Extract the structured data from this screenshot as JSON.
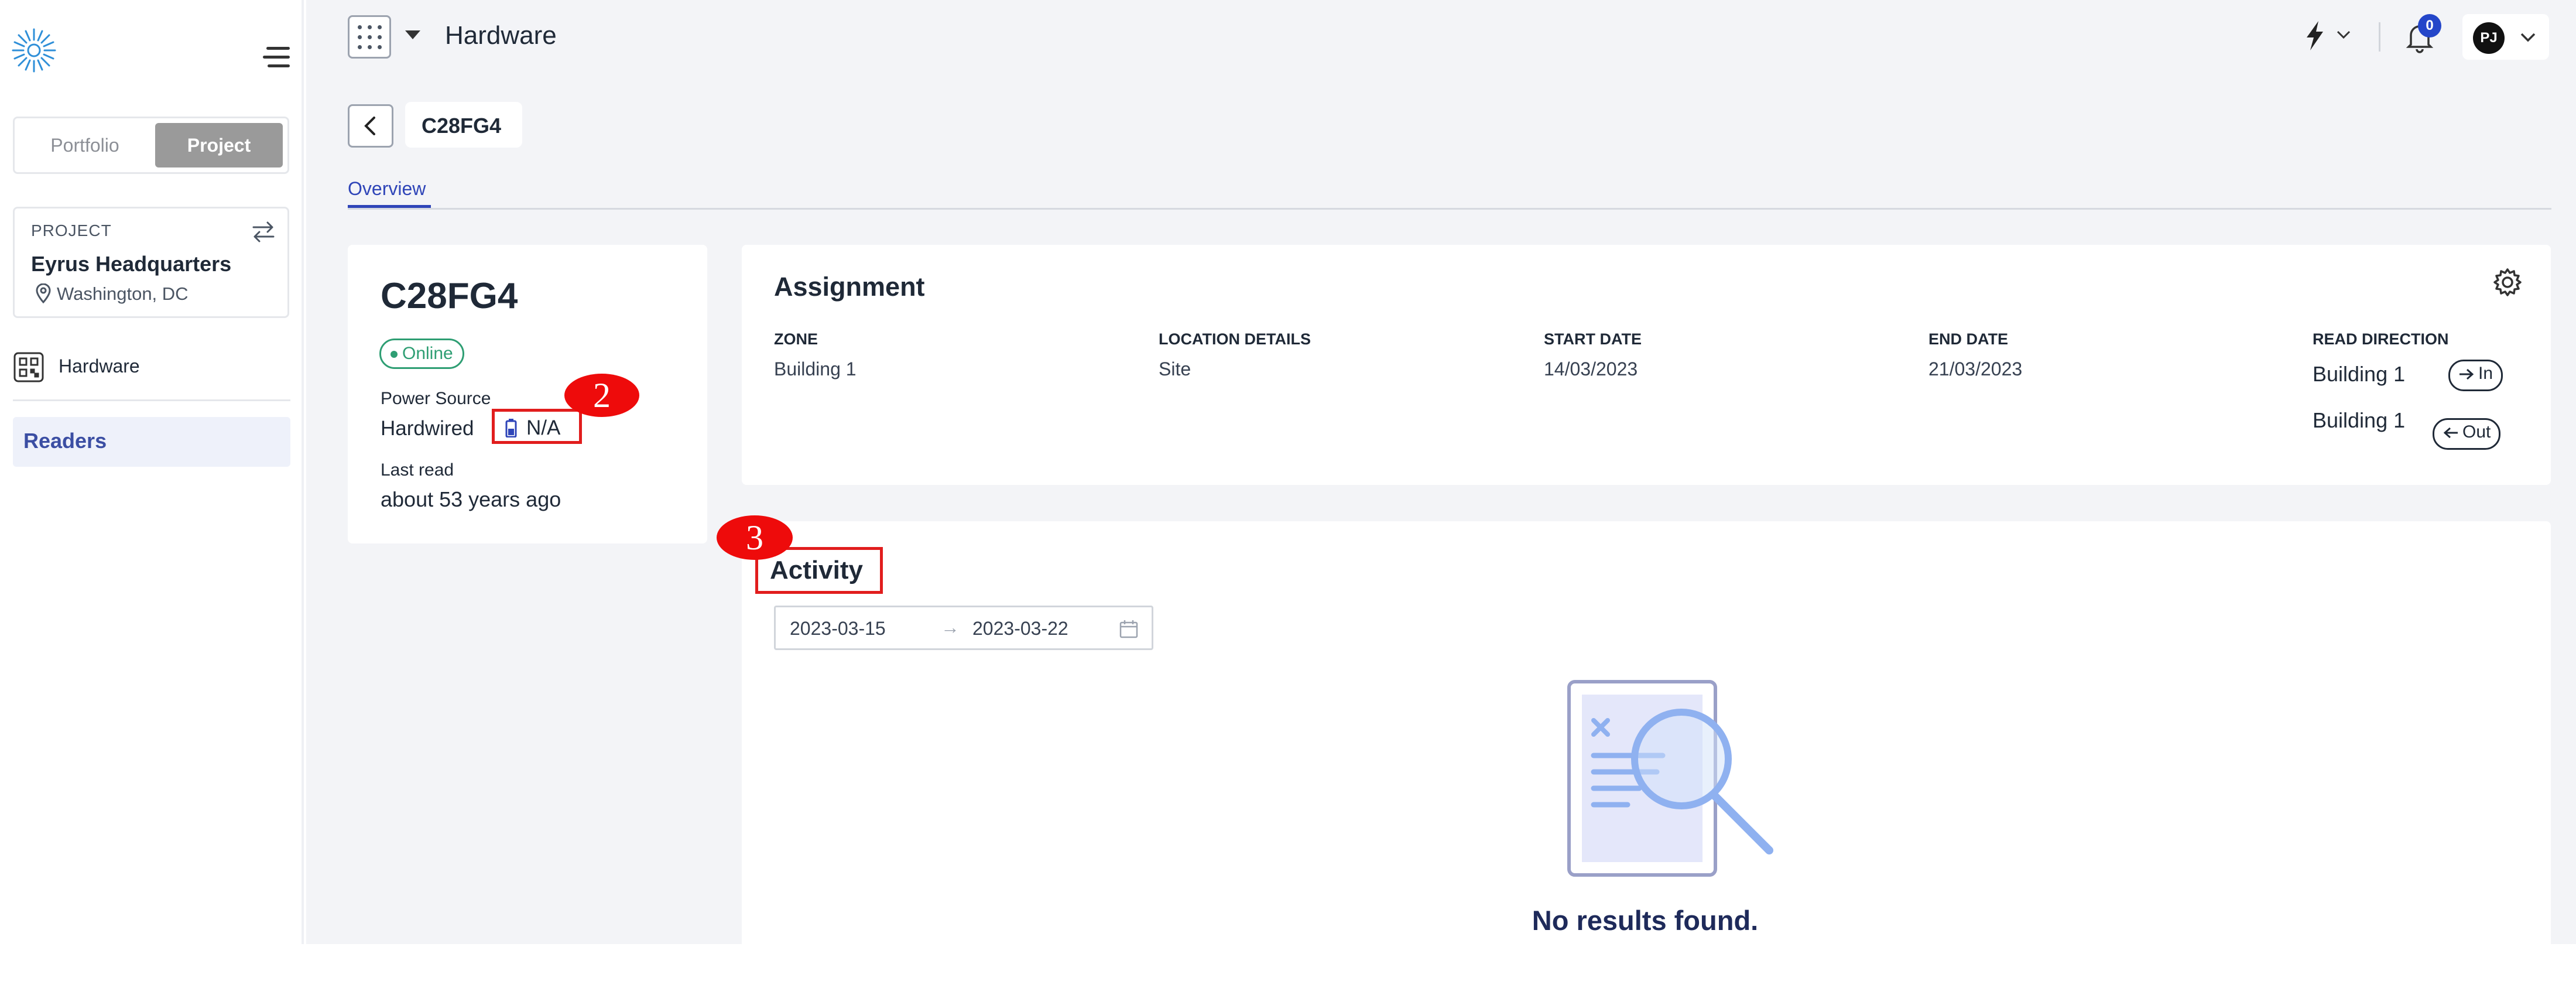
{
  "sidebar": {
    "toggle": {
      "portfolio": "Portfolio",
      "project": "Project"
    },
    "project_card": {
      "label": "PROJECT",
      "name": "Eyrus Headquarters",
      "location": "Washington, DC"
    },
    "nav": {
      "hardware": "Hardware",
      "readers": "Readers"
    }
  },
  "header": {
    "title": "Hardware",
    "notifications_count": "0",
    "user_initials": "PJ"
  },
  "breadcrumb": {
    "current": "C28FG4"
  },
  "tabs": {
    "overview": "Overview"
  },
  "device": {
    "name": "C28FG4",
    "status": "Online",
    "power_label": "Power Source",
    "power_value": "Hardwired",
    "battery": "N/A",
    "last_read_label": "Last read",
    "last_read_value": "about 53 years ago"
  },
  "assignment": {
    "title": "Assignment",
    "columns": {
      "zone": "ZONE",
      "location": "LOCATION DETAILS",
      "start": "START DATE",
      "end": "END DATE",
      "direction": "READ DIRECTION"
    },
    "values": {
      "zone": "Building 1",
      "location": "Site",
      "start": "14/03/2023",
      "end": "21/03/2023"
    },
    "directions": [
      {
        "building": "Building 1",
        "dir": "In"
      },
      {
        "building": "Building 1",
        "dir": "Out"
      }
    ]
  },
  "activity": {
    "title": "Activity",
    "date_start": "2023-03-15",
    "date_end": "2023-03-22",
    "date_separator": "→",
    "empty_message": "No results found."
  },
  "annotations": {
    "marker_2": "2",
    "marker_3": "3"
  },
  "colors": {
    "accent": "#2f45b8",
    "online": "#2e9e73",
    "annotation_red": "#e11d1d",
    "marker_red": "#ee0b0b"
  },
  "icons": [
    "logo-sunburst-icon",
    "menu-icon",
    "switch-icon",
    "location-pin-icon",
    "qr-hardware-icon",
    "apps-grid-icon",
    "caret-down-icon",
    "bolt-icon",
    "bell-icon",
    "chevron-down-icon",
    "chevron-left-icon",
    "battery-icon",
    "gear-icon",
    "arrow-right-icon",
    "arrow-left-icon",
    "calendar-icon",
    "empty-search-illustration"
  ]
}
